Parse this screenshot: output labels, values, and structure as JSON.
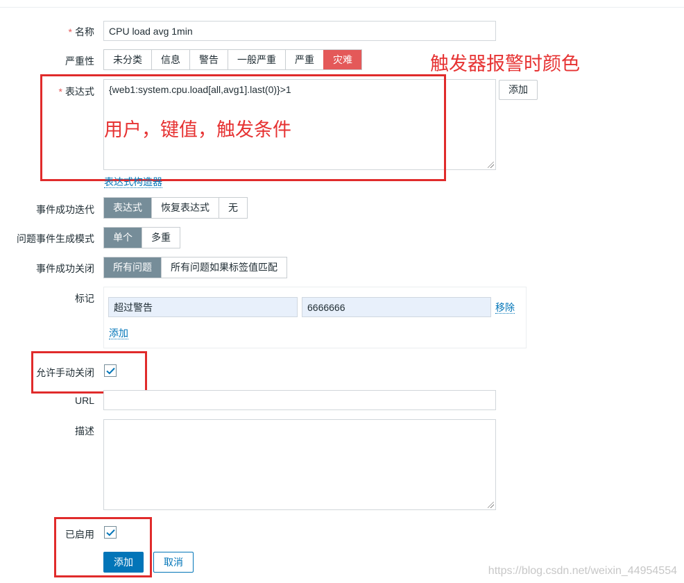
{
  "form": {
    "name": {
      "label": "名称",
      "value": "CPU load avg 1min"
    },
    "severity": {
      "label": "严重性",
      "options": [
        "未分类",
        "信息",
        "警告",
        "一般严重",
        "严重",
        "灾难"
      ],
      "selected": "灾难"
    },
    "expression": {
      "label": "表达式",
      "value": "{web1:system.cpu.load[all,avg1].last(0)}>1",
      "add_button": "添加",
      "constructor_link": "表达式构造器"
    },
    "ok_event_generation": {
      "label": "事件成功迭代",
      "options": [
        "表达式",
        "恢复表达式",
        "无"
      ],
      "selected": "表达式"
    },
    "problem_event_mode": {
      "label": "问题事件生成模式",
      "options": [
        "单个",
        "多重"
      ],
      "selected": "单个"
    },
    "ok_event_closes": {
      "label": "事件成功关闭",
      "options": [
        "所有问题",
        "所有问题如果标签值匹配"
      ],
      "selected": "所有问题"
    },
    "tags": {
      "label": "标记",
      "rows": [
        {
          "tag": "超过警告",
          "value": "6666666",
          "remove": "移除"
        }
      ],
      "add_link": "添加"
    },
    "allow_manual_close": {
      "label": "允许手动关闭",
      "checked": true
    },
    "url": {
      "label": "URL",
      "value": ""
    },
    "description": {
      "label": "描述",
      "value": ""
    },
    "enabled": {
      "label": "已启用",
      "checked": true
    },
    "buttons": {
      "submit": "添加",
      "cancel": "取消"
    }
  },
  "annotations": {
    "severity_note": "触发器报警时颜色",
    "expression_note": "用户，键值，触发条件"
  },
  "watermark": "https://blog.csdn.net/weixin_44954554",
  "colors": {
    "annotation_red": "#e02b2b",
    "primary_blue": "#0275b8",
    "selected_segment": "#768d99",
    "disaster": "#e45959"
  }
}
